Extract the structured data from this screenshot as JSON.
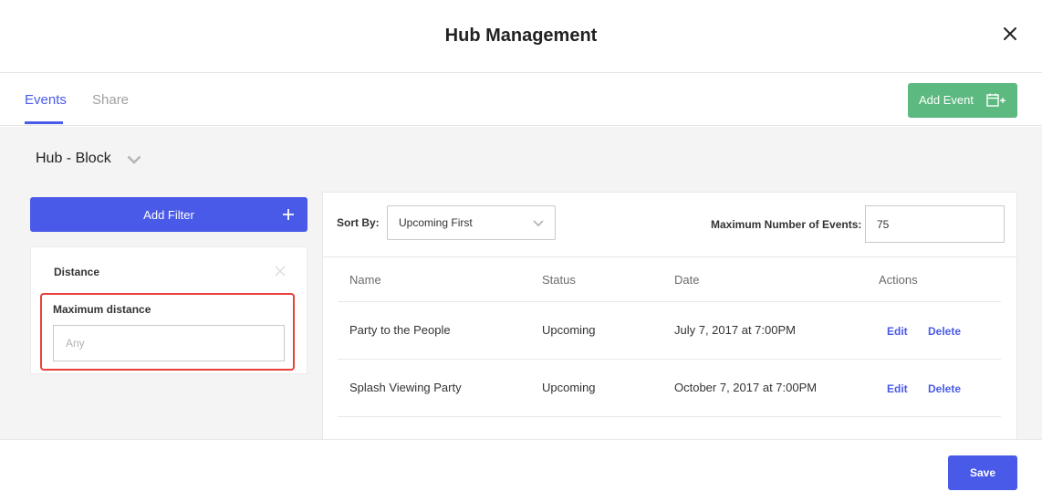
{
  "header": {
    "title": "Hub Management"
  },
  "tabs": [
    {
      "label": "Events",
      "active": true
    },
    {
      "label": "Share",
      "active": false
    }
  ],
  "add_event": {
    "label": "Add Event",
    "icon": "calendar-plus-icon"
  },
  "hub_selector": {
    "value": "Hub - Block"
  },
  "filters": {
    "add_label": "Add Filter",
    "card": {
      "title": "Distance",
      "field_label": "Maximum distance",
      "field_placeholder": "Any",
      "field_value": ""
    }
  },
  "sort": {
    "label": "Sort By:",
    "value": "Upcoming First"
  },
  "max_events": {
    "label": "Maximum Number of Events:",
    "value": "75"
  },
  "table": {
    "headers": [
      "Name",
      "Status",
      "Date",
      "Actions"
    ],
    "rows": [
      {
        "name": "Party to the People",
        "status": "Upcoming",
        "date": "July 7, 2017 at 7:00PM",
        "edit": "Edit",
        "delete": "Delete"
      },
      {
        "name": "Splash Viewing Party",
        "status": "Upcoming",
        "date": "October 7, 2017 at 7:00PM",
        "edit": "Edit",
        "delete": "Delete"
      }
    ]
  },
  "footer": {
    "save_label": "Save"
  },
  "colors": {
    "primary": "#4a5ae8",
    "success": "#5cb97f",
    "highlight": "#e8403a"
  }
}
